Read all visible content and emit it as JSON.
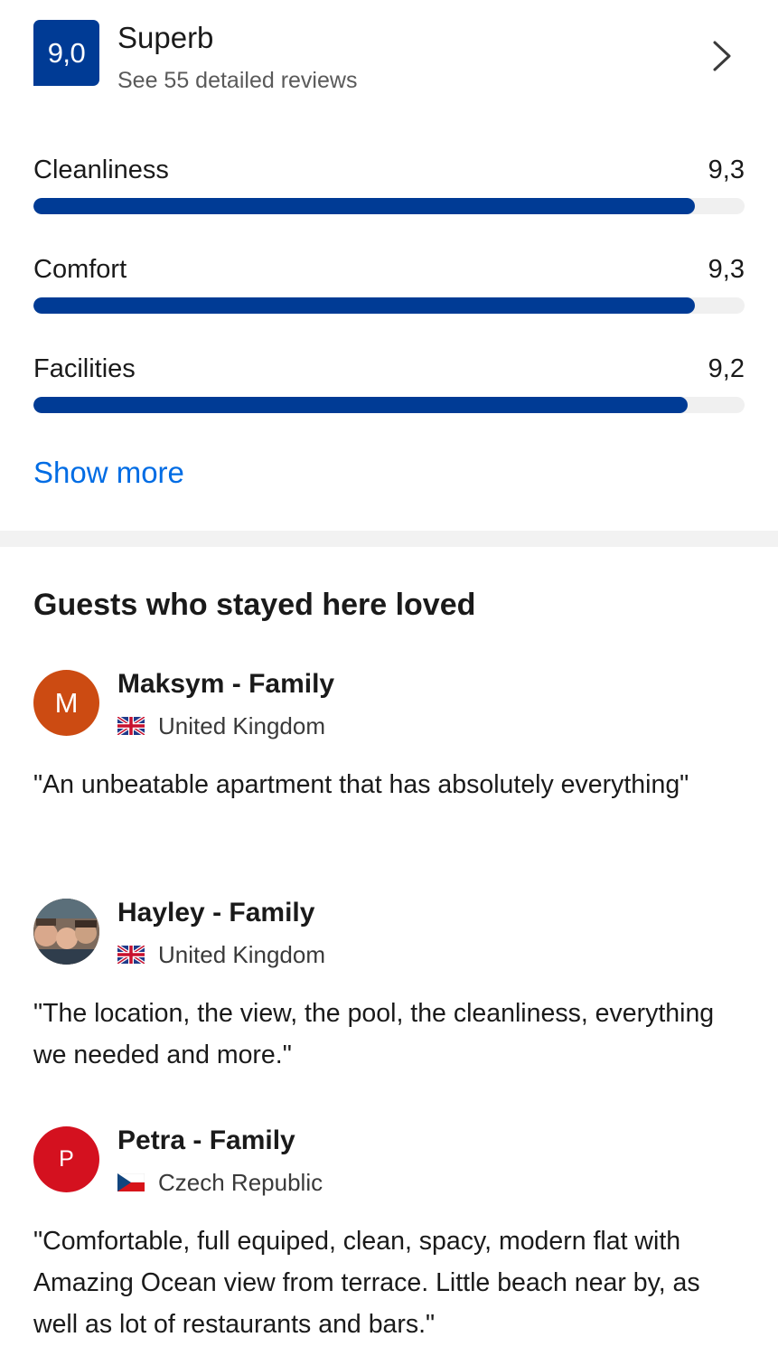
{
  "score": {
    "value": "9,0",
    "label": "Superb",
    "reviews_link": "See 55 detailed reviews"
  },
  "categories": [
    {
      "name": "Cleanliness",
      "score": "9,3",
      "fraction": 0.93
    },
    {
      "name": "Comfort",
      "score": "9,3",
      "fraction": 0.93
    },
    {
      "name": "Facilities",
      "score": "9,2",
      "fraction": 0.92
    }
  ],
  "show_more": "Show more",
  "section_title": "Guests who stayed here loved",
  "reviews": [
    {
      "avatar_letter": "M",
      "avatar_color": "#cc4b12",
      "name": "Maksym - Family",
      "country": "United Kingdom",
      "flag_icon": "uk-flag-icon",
      "text": "\"An unbeatable apartment that has absolutely everything\""
    },
    {
      "avatar_letter": "",
      "avatar_color": "#6b5a4e",
      "name": "Hayley - Family",
      "country": "United Kingdom",
      "flag_icon": "uk-flag-icon",
      "text": "\"The location, the view, the pool, the cleanliness, everything we needed and more.\""
    },
    {
      "avatar_letter": "P",
      "avatar_color": "#d4111f",
      "name": "Petra - Family",
      "country": "Czech Republic",
      "flag_icon": "czech-flag-icon",
      "text": "\"Comfortable, full equiped, clean, spacy, modern flat with Amazing  Ocean view from terrace. Little beach near by, as well as lot of restaurants and bars.\""
    }
  ],
  "colors": {
    "brand_blue": "#003b95",
    "link_blue": "#006ce4",
    "track_gray": "#f0f0f0"
  }
}
